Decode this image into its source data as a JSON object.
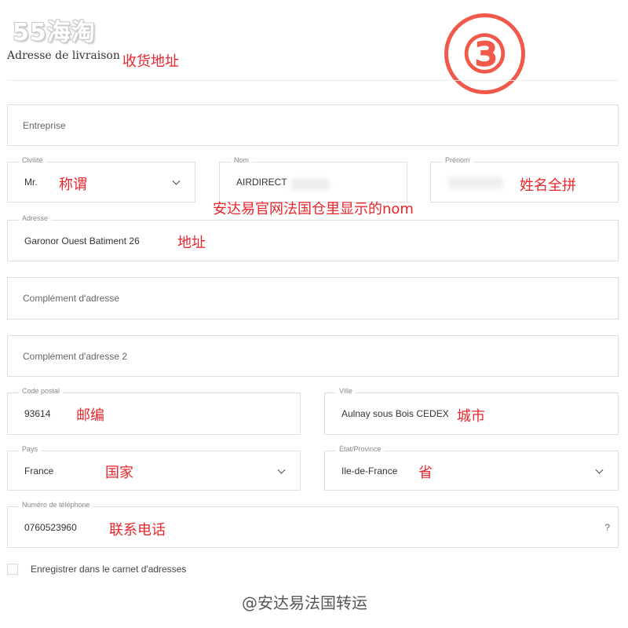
{
  "logo": "55海淘",
  "step_number": "③",
  "section": {
    "title": "Adresse de livraison",
    "annotation": "收货地址"
  },
  "fields": {
    "entreprise": {
      "placeholder": "Entreprise"
    },
    "civilite": {
      "label": "Civilité",
      "value": "Mr.",
      "annotation": "称谓"
    },
    "nom": {
      "label": "Nom",
      "value": "AIRDIRECT",
      "annotation": "安达易官网法国仓里显示的nom"
    },
    "prenom": {
      "label": "Prénom",
      "value": "",
      "annotation": "姓名全拼"
    },
    "adresse": {
      "label": "Adresse",
      "value": "Garonor Ouest Batiment 26",
      "annotation": "地址"
    },
    "complement1": {
      "placeholder": "Complément d'adresse"
    },
    "complement2": {
      "placeholder": "Complément d'adresse 2"
    },
    "code_postal": {
      "label": "Code postal",
      "value": "93614",
      "annotation": "邮编"
    },
    "ville": {
      "label": "Ville",
      "value": "Aulnay sous Bois CEDEX",
      "annotation": "城市"
    },
    "pays": {
      "label": "Pays",
      "value": "France",
      "annotation": "国家"
    },
    "etat": {
      "label": "État/Province",
      "value": "Ile-de-France",
      "annotation": "省"
    },
    "telephone": {
      "label": "Numéro de téléphone",
      "value": "0760523960",
      "annotation": "联系电话",
      "help": "?"
    }
  },
  "checkbox": {
    "label": "Enregistrer dans le carnet d'adresses",
    "checked": false
  },
  "watermark": "@安达易法国转运",
  "colors": {
    "annotation_red": "#e8252b",
    "step_circle": "#f15a4a",
    "border": "#dedede"
  }
}
